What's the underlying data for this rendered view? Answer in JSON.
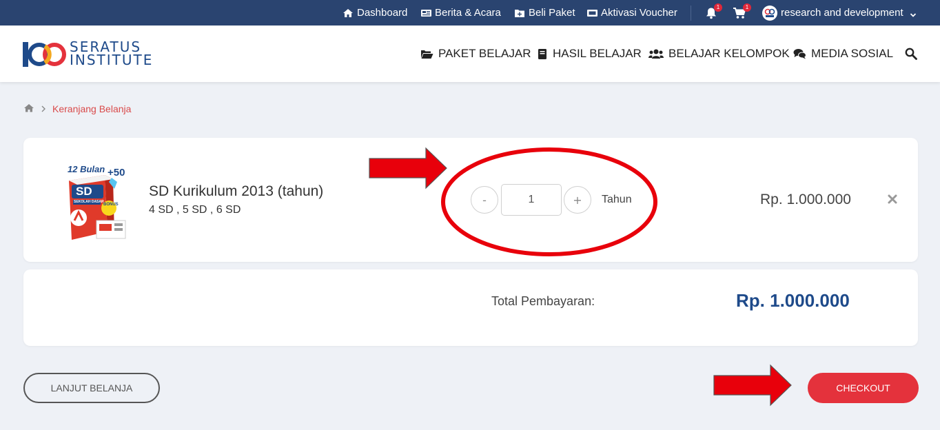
{
  "topbar": {
    "dashboard": "Dashboard",
    "news": "Berita & Acara",
    "buy": "Beli Paket",
    "voucher": "Aktivasi Voucher",
    "notif_count": "1",
    "cart_count": "1",
    "user": "research and development"
  },
  "brand": {
    "line1": "SERATUS",
    "line2": "INSTITUTE"
  },
  "nav": {
    "paket": "PAKET BELAJAR",
    "hasil": "HASIL BELAJAR",
    "kelompok": "BELAJAR KELOMPOK",
    "sosial": "MEDIA SOSIAL"
  },
  "breadcrumb": {
    "current": "Keranjang Belanja"
  },
  "cart": {
    "item": {
      "name": "SD Kurikulum 2013 (tahun)",
      "levels": "4 SD , 5 SD , 6 SD",
      "minus": "-",
      "plus": "+",
      "quantity": "1",
      "unit": "Tahun",
      "price": "Rp. 1.000.000",
      "box_text_top": "12 Bulan",
      "box_text_num": "+50",
      "box_text_main": "SD",
      "box_text_sub": "SEKOLAH DASAR",
      "box_text_bonus": "BONUS"
    },
    "total_label": "Total Pembayaran:",
    "total_value": "Rp. 1.000.000"
  },
  "buttons": {
    "continue": "LANJUT BELANJA",
    "checkout": "CHECKOUT"
  },
  "colors": {
    "topbar": "#2a4470",
    "brand_blue": "#1e4a8a",
    "checkout_red": "#e4323c",
    "annotation_red": "#e8000b"
  }
}
